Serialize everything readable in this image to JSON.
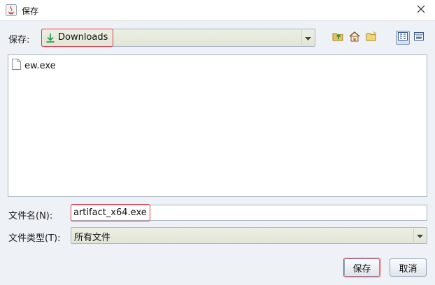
{
  "window": {
    "title": "保存"
  },
  "save_in": {
    "label": "保存:",
    "folder": "Downloads"
  },
  "toolbar": {
    "icons": [
      "up-one-level-icon",
      "home-icon",
      "new-folder-icon",
      "list-view-icon",
      "details-view-icon"
    ]
  },
  "files": [
    {
      "name": "ew.exe",
      "icon": "file-icon"
    }
  ],
  "filename": {
    "label": "文件名(N):",
    "value": "artifact_x64.exe"
  },
  "filetype": {
    "label": "文件类型(T):",
    "selected": "所有文件"
  },
  "buttons": {
    "save": "保存",
    "cancel": "取消"
  },
  "colors": {
    "highlight": "#e23a4a",
    "background": "#eef2f6",
    "combo": "#e6e9dc"
  }
}
